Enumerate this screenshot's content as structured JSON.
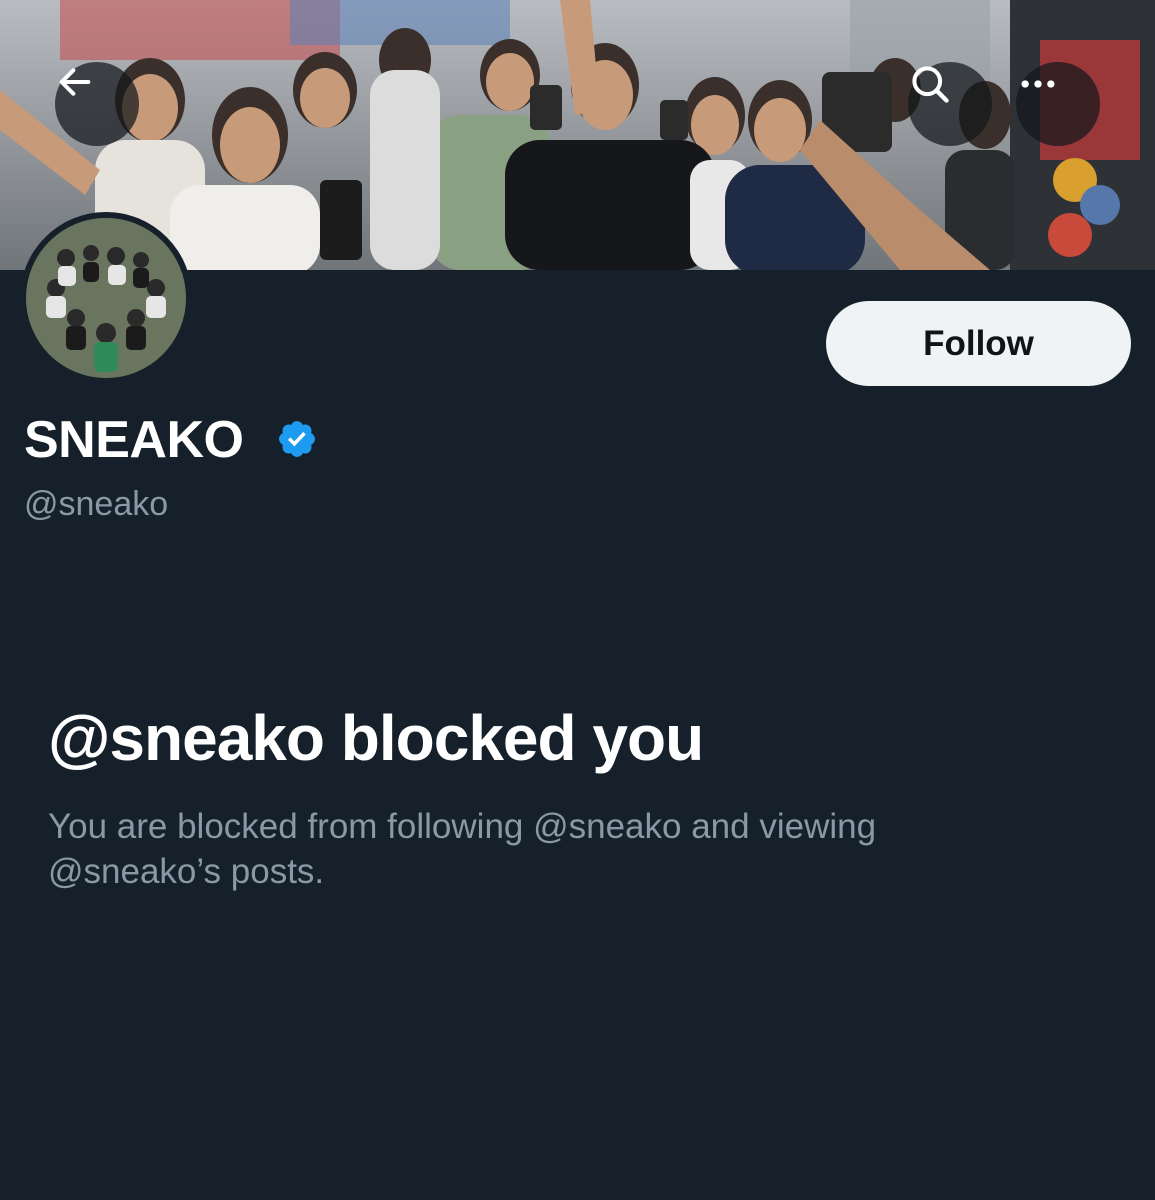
{
  "profile": {
    "display_name": "SNEAKO",
    "handle": "@sneako",
    "verified": true,
    "follow_label": "Follow"
  },
  "blocked": {
    "title": "@sneako blocked you",
    "description": "You are blocked from following @sneako and viewing @sneako’s posts."
  },
  "icons": {
    "back": "arrow-left-icon",
    "search": "search-icon",
    "more": "more-horizontal-icon",
    "verified": "verified-badge-icon"
  },
  "colors": {
    "background": "#15202b",
    "primary_text": "#ffffff",
    "secondary_text": "#8b98a5",
    "follow_button_bg": "#eff3f4",
    "verified_blue": "#1d9bf0"
  }
}
